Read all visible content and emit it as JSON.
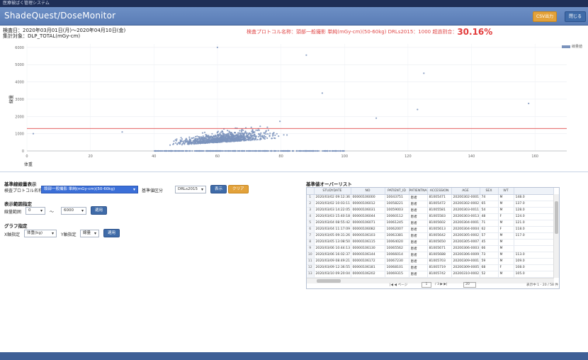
{
  "topbar": {
    "text": "医療被ばく管理システム"
  },
  "header": {
    "title": "ShadeQuest/DoseMonitor",
    "btn_export": "CSV出力",
    "btn_close": "閉じる"
  },
  "info": {
    "date_range": "検査日：2020年03月01日(月)～2020年04月10日(金)",
    "target": "集計対象：DLP_TOTAL(mGy-cm)"
  },
  "alert": {
    "text": "検査プロトコル名称：頭部一般撮影 単純(mGy-cm)(50-60kg)  DRLs2015：1000  超過割合：",
    "pct": "30.16%"
  },
  "chart_data": {
    "type": "scatter",
    "ylabel": "線量",
    "xlabel": "体重",
    "yticks": [
      "0",
      "1000",
      "2000",
      "3000",
      "4000",
      "5000",
      "6000"
    ],
    "xticks": [
      "0",
      "20",
      "40",
      "60",
      "80",
      "100",
      "120",
      "140",
      "160"
    ],
    "xlim": [
      0,
      170
    ],
    "ylim": [
      0,
      6200
    ],
    "reference_line": 1300,
    "reference_color": "#e04a4a",
    "point_color": "#7b93bc",
    "legend": "線量値",
    "legend_position": "top-right"
  },
  "panel": {
    "sec1": "基準線線量表示",
    "protocol_label": "検査プロトコル名称",
    "protocol_value": "頭部一般撮影 単純(mGy-cm)(50-60kg)",
    "ref_label": "基準値区分",
    "ref_value": "DRLs2015",
    "btn_apply": "表示",
    "btn_clear": "クリア",
    "sec2": "表示範囲指定",
    "range_label": "線量範囲",
    "range_min": "0",
    "range_sep": "～",
    "range_max": "6000",
    "btn_range": "適用",
    "sec3": "グラフ指定",
    "xaxis_label": "X軸指定",
    "xaxis_value": "体重(kg)",
    "yaxis_label": "Y軸指定",
    "yaxis_value": "線量",
    "btn_graph": "適用"
  },
  "table": {
    "title": "基準値オーバーリスト",
    "columns": [
      "",
      "STUDYDATE",
      "NO",
      "PATIENT_ID",
      "PATIENTNAME",
      "ACCESSION",
      "AGE",
      "SEX",
      "WT"
    ],
    "rows": [
      [
        "1",
        "2020/03/02 09:12:36",
        "00000106000",
        "10043751",
        "患者",
        "81005471",
        "20200302-0001",
        "74",
        "M",
        "148.0"
      ],
      [
        "2",
        "2020/03/02 10:03:11",
        "00000106012",
        "10058221",
        "患者",
        "81005472",
        "20200302-0002",
        "65",
        "M",
        "137.0"
      ],
      [
        "3",
        "2020/03/03 14:22:05",
        "00000106031",
        "10059003",
        "患者",
        "81005581",
        "20200303-0011",
        "54",
        "M",
        "128.0"
      ],
      [
        "4",
        "2020/03/03 15:40:18",
        "00000106044",
        "10060112",
        "患者",
        "81005583",
        "20200303-0013",
        "48",
        "F",
        "124.0"
      ],
      [
        "5",
        "2020/03/04 08:55:42",
        "00000106071",
        "10061245",
        "患者",
        "81005602",
        "20200304-0001",
        "71",
        "M",
        "121.0"
      ],
      [
        "6",
        "2020/03/04 11:17:09",
        "00000106082",
        "10062007",
        "患者",
        "81005613",
        "20200304-0004",
        "62",
        "F",
        "118.0"
      ],
      [
        "7",
        "2020/03/05 09:31:26",
        "00000106103",
        "10063381",
        "患者",
        "81005642",
        "20200305-0002",
        "57",
        "M",
        "117.0"
      ],
      [
        "8",
        "2020/03/05 13:08:50",
        "00000106115",
        "10064020",
        "患者",
        "81005650",
        "20200305-0007",
        "45",
        "M",
        ""
      ],
      [
        "9",
        "2020/03/06 10:44:13",
        "00000106130",
        "10065562",
        "患者",
        "81005671",
        "20200306-0003",
        "66",
        "M",
        ""
      ],
      [
        "10",
        "2020/03/06 16:02:37",
        "00000106144",
        "10066014",
        "患者",
        "81005688",
        "20200306-0009",
        "73",
        "M",
        "113.0"
      ],
      [
        "11",
        "2020/03/09 08:49:21",
        "00000106172",
        "10067230",
        "患者",
        "81005703",
        "20200309-0001",
        "59",
        "M",
        "109.0"
      ],
      [
        "12",
        "2020/03/09 12:36:55",
        "00000106181",
        "10068101",
        "患者",
        "81005719",
        "20200309-0005",
        "68",
        "F",
        "108.0"
      ],
      [
        "13",
        "2020/03/10 09:20:04",
        "00000106202",
        "10069315",
        "患者",
        "81005742",
        "20200310-0002",
        "52",
        "M",
        "105.0"
      ]
    ],
    "pager_nav": "|◀  ◀  ページ",
    "pager_page": "1",
    "pager_of": "/ 3  ▶  ▶|",
    "pager_size": "20",
    "pager_info": "表示中 1 - 20 / 58 件"
  }
}
